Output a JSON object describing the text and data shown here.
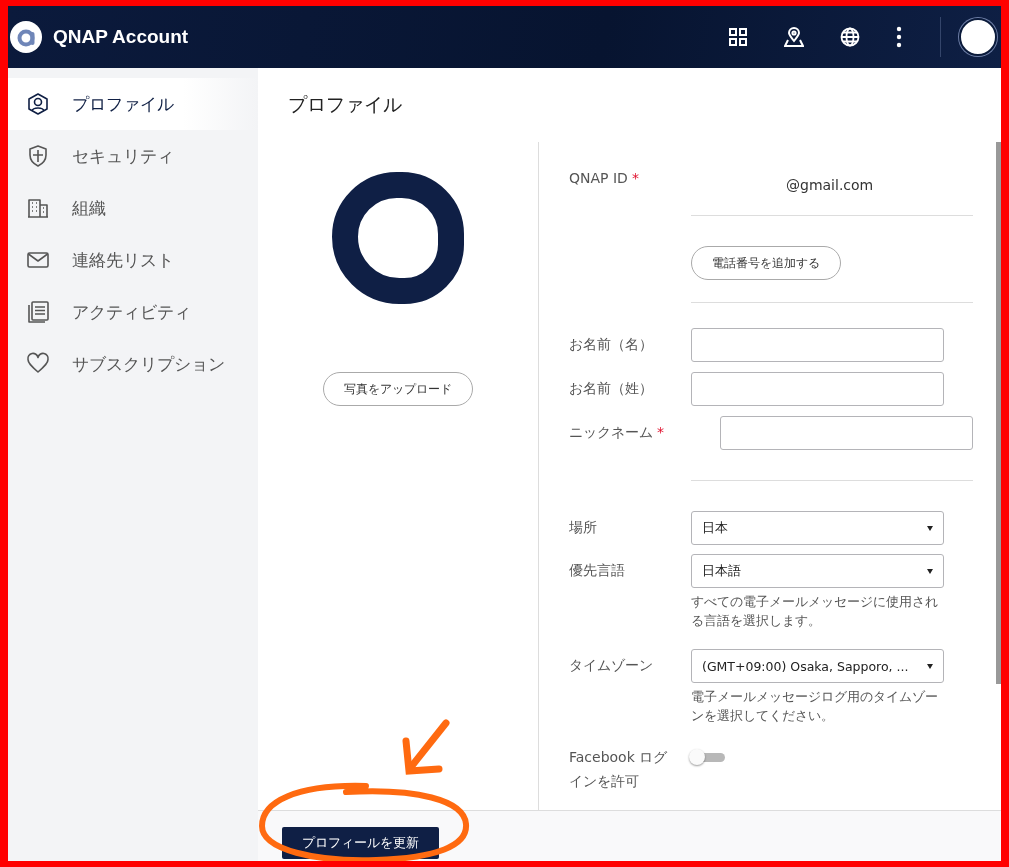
{
  "header": {
    "title": "QNAP Account"
  },
  "sidebar": {
    "items": [
      {
        "label": "プロファイル",
        "selected": true
      },
      {
        "label": "セキュリティ",
        "selected": false
      },
      {
        "label": "組織",
        "selected": false
      },
      {
        "label": "連絡先リスト",
        "selected": false
      },
      {
        "label": "アクティビティ",
        "selected": false
      },
      {
        "label": "サブスクリプション",
        "selected": false
      }
    ]
  },
  "page": {
    "title": "プロファイル",
    "upload_button": "写真をアップロード"
  },
  "form": [
    {
      "kind": "text",
      "label": "QNAP ID",
      "required_mark": "*",
      "value": "@gmail.com"
    },
    {
      "kind": "divider"
    },
    {
      "kind": "button",
      "label": "電話番号を追加する"
    },
    {
      "kind": "divider"
    },
    {
      "kind": "input",
      "label": "お名前（名）"
    },
    {
      "kind": "input",
      "label": "お名前（姓）"
    },
    {
      "kind": "input",
      "label": "ニックネーム",
      "required_mark": "*"
    },
    {
      "kind": "divider"
    },
    {
      "kind": "select",
      "label": "場所",
      "value": "日本"
    },
    {
      "kind": "select",
      "label": "優先言語",
      "value": "日本語",
      "help": "すべての電子メールメッセージに使用される言語を選択します。"
    },
    {
      "kind": "select",
      "label": "タイムゾーン",
      "value": "(GMT+09:00) Osaka, Sapporo, ...",
      "help": "電子メールメッセージログ用のタイムゾーンを選択してください。"
    },
    {
      "kind": "toggle",
      "label": "Facebook ログインを許可",
      "on": false
    }
  ],
  "footer": {
    "button": "プロフィールを更新"
  }
}
